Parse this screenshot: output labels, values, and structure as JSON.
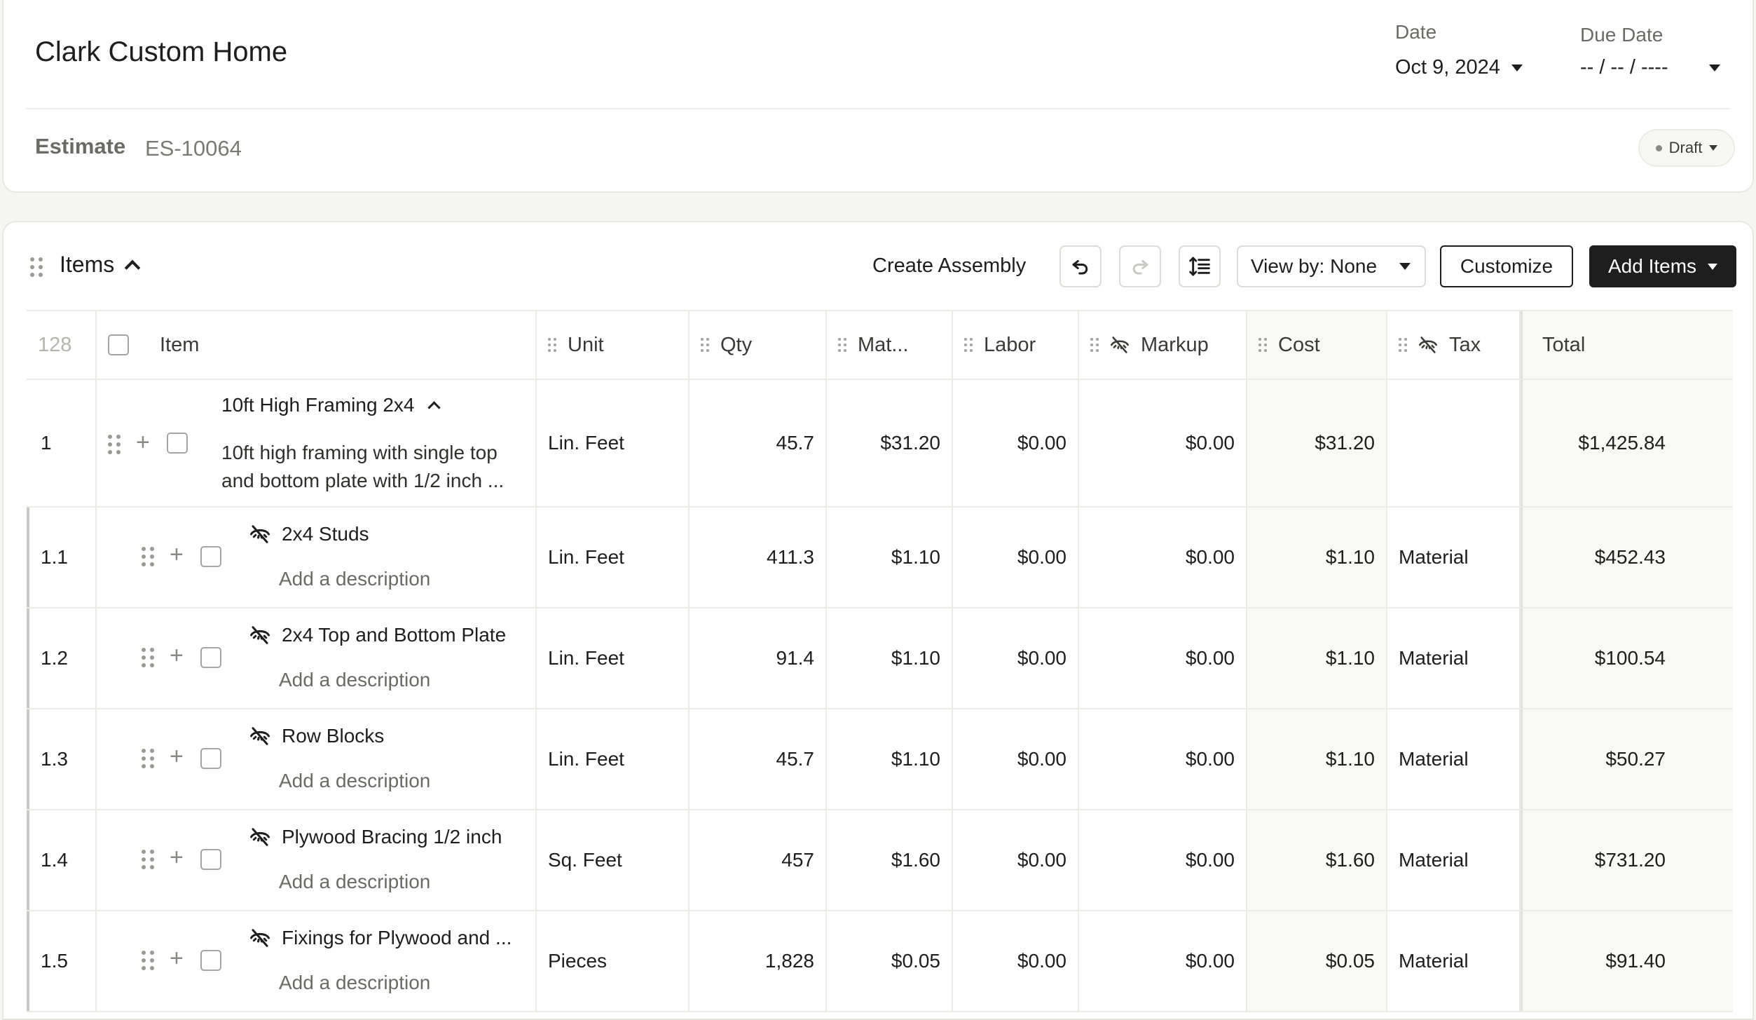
{
  "header": {
    "title": "Clark Custom Home",
    "date_label": "Date",
    "date_value": "Oct 9, 2024",
    "due_label": "Due Date",
    "due_value": "-- / -- / ----",
    "estimate_label": "Estimate",
    "estimate_number": "ES-10064",
    "status": "Draft"
  },
  "items_section": {
    "title": "Items",
    "create_assembly": "Create Assembly",
    "view_by": "View by: None",
    "customize": "Customize",
    "add_items": "Add Items"
  },
  "table": {
    "row_count": "128",
    "columns": {
      "item": "Item",
      "unit": "Unit",
      "qty": "Qty",
      "material": "Mat...",
      "labor": "Labor",
      "markup": "Markup",
      "cost": "Cost",
      "tax": "Tax",
      "total": "Total"
    },
    "parent": {
      "num": "1",
      "name": "10ft High Framing 2x4",
      "desc_line1": "10ft high framing with single top",
      "desc_line2": "and bottom plate with 1/2 inch ...",
      "unit": "Lin. Feet",
      "qty": "45.7",
      "material": "$31.20",
      "labor": "$0.00",
      "markup": "$0.00",
      "cost": "$31.20",
      "tax": "",
      "total": "$1,425.84"
    },
    "children": [
      {
        "num": "1.1",
        "name": "2x4 Studs",
        "desc": "Add a description",
        "unit": "Lin. Feet",
        "qty": "411.3",
        "material": "$1.10",
        "labor": "$0.00",
        "markup": "$0.00",
        "cost": "$1.10",
        "tax": "Material",
        "total": "$452.43"
      },
      {
        "num": "1.2",
        "name": "2x4 Top and Bottom Plate",
        "desc": "Add a description",
        "unit": "Lin. Feet",
        "qty": "91.4",
        "material": "$1.10",
        "labor": "$0.00",
        "markup": "$0.00",
        "cost": "$1.10",
        "tax": "Material",
        "total": "$100.54"
      },
      {
        "num": "1.3",
        "name": "Row Blocks",
        "desc": "Add a description",
        "unit": "Lin. Feet",
        "qty": "45.7",
        "material": "$1.10",
        "labor": "$0.00",
        "markup": "$0.00",
        "cost": "$1.10",
        "tax": "Material",
        "total": "$50.27"
      },
      {
        "num": "1.4",
        "name": "Plywood Bracing 1/2 inch",
        "desc": "Add a description",
        "unit": "Sq. Feet",
        "qty": "457",
        "material": "$1.60",
        "labor": "$0.00",
        "markup": "$0.00",
        "cost": "$1.60",
        "tax": "Material",
        "total": "$731.20"
      },
      {
        "num": "1.5",
        "name": "Fixings for Plywood and ...",
        "desc": "Add a description",
        "unit": "Pieces",
        "qty": "1,828",
        "material": "$0.05",
        "labor": "$0.00",
        "markup": "$0.00",
        "cost": "$0.05",
        "tax": "Material",
        "total": "$91.40"
      }
    ]
  },
  "icons": {
    "undo": "undo-icon",
    "redo": "redo-icon",
    "row_height": "row-height-icon",
    "hidden": "eye-off-icon",
    "drag": "drag-handle-icon"
  }
}
